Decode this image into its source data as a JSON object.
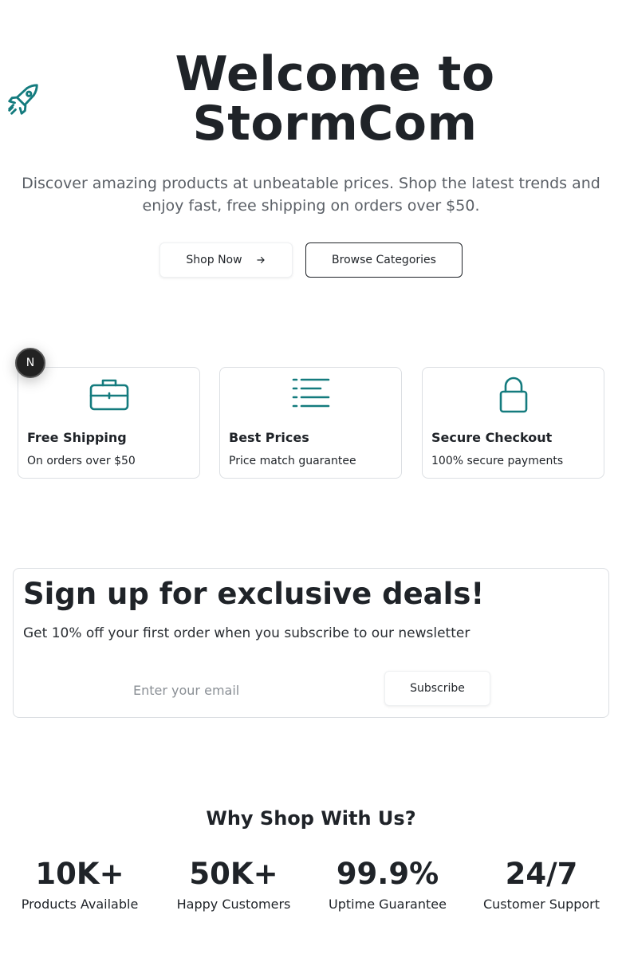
{
  "hero": {
    "title": "Welcome to StormCom",
    "subtitle": "Discover amazing products at unbeatable prices. Shop the latest trends and enjoy fast, free shipping on orders over $50.",
    "shop_now_label": "Shop Now",
    "browse_label": "Browse Categories",
    "rocket_icon": "rocket-icon"
  },
  "badge": {
    "label": "N"
  },
  "features": [
    {
      "icon": "briefcase-icon",
      "title": "Free Shipping",
      "description": "On orders over $50"
    },
    {
      "icon": "list-icon",
      "title": "Best Prices",
      "description": "Price match guarantee"
    },
    {
      "icon": "lock-icon",
      "title": "Secure Checkout",
      "description": "100% secure payments"
    }
  ],
  "newsletter": {
    "title": "Sign up for exclusive deals!",
    "subtitle": "Get 10% off your first order when you subscribe to our newsletter",
    "email_placeholder": "Enter your email",
    "email_value": "",
    "subscribe_label": "Subscribe"
  },
  "why": {
    "title": "Why Shop With Us?",
    "stats": [
      {
        "value": "10K+",
        "label": "Products Available"
      },
      {
        "value": "50K+",
        "label": "Happy Customers"
      },
      {
        "value": "99.9%",
        "label": "Uptime Guarantee"
      },
      {
        "value": "24/7",
        "label": "Customer Support"
      }
    ]
  },
  "colors": {
    "accent": "#147b7e",
    "text": "#1f2328",
    "muted": "#5b6067",
    "border": "#dcdfe3"
  }
}
